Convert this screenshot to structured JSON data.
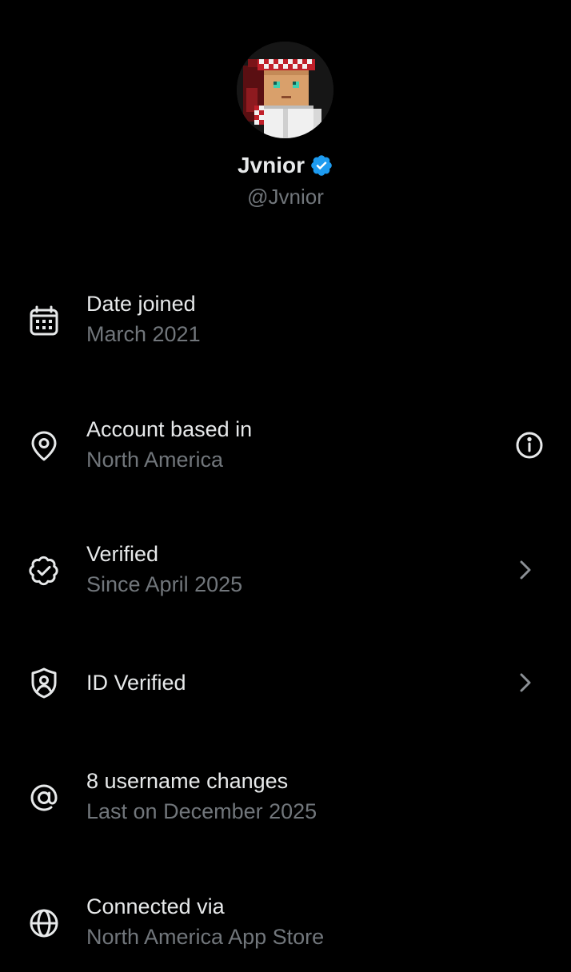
{
  "profile": {
    "display_name": "Jvnior",
    "handle": "@Jvnior",
    "verified_badge_icon": "verified-badge-icon",
    "badge_color": "#1d9bf0"
  },
  "colors": {
    "background": "#000000",
    "primary_text": "#e7e9ea",
    "secondary_text": "#71767b"
  },
  "rows": [
    {
      "icon": "calendar-icon",
      "title": "Date joined",
      "subtitle": "March 2021"
    },
    {
      "icon": "location-pin-icon",
      "title": "Account based in",
      "subtitle": "North America",
      "action_icon": "info-icon"
    },
    {
      "icon": "verified-check-icon",
      "title": "Verified",
      "subtitle": "Since April 2025",
      "action_icon": "chevron-right-icon"
    },
    {
      "icon": "id-shield-icon",
      "title": "ID Verified",
      "action_icon": "chevron-right-icon"
    },
    {
      "icon": "at-sign-icon",
      "title": "8 username changes",
      "subtitle": "Last on December 2025"
    },
    {
      "icon": "globe-icon",
      "title": "Connected via",
      "subtitle": "North America App Store"
    }
  ]
}
